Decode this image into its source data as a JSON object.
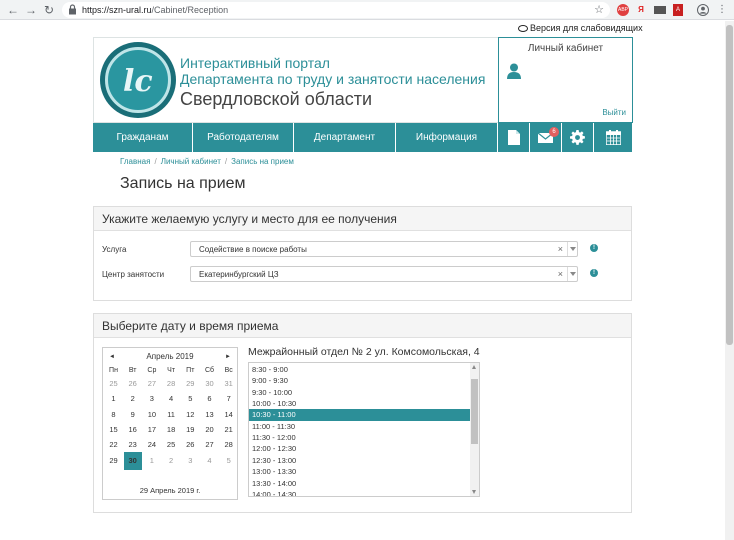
{
  "browser": {
    "url_host": "https://szn-ural.ru",
    "url_path": "/Cabinet/Reception"
  },
  "a11y_link": "Версия для слабовидящих",
  "header": {
    "line1": "Интерактивный портал",
    "line2": "Департамента по труду и занятости населения",
    "line3": "Свердловской области",
    "cabinet_title": "Личный кабинет",
    "logout": "Выйти"
  },
  "nav": {
    "items": [
      "Гражданам",
      "Работодателям",
      "Департамент",
      "Информация"
    ],
    "mail_count": "6"
  },
  "breadcrumb": [
    "Главная",
    "Личный кабинет",
    "Запись на прием"
  ],
  "page_title": "Запись на прием",
  "service_panel": {
    "title": "Укажите желаемую услугу и место для ее получения",
    "service_label": "Услуга",
    "service_value": "Содействие в поиске работы",
    "center_label": "Центр занятости",
    "center_value": "Екатеринбургский ЦЗ"
  },
  "date_panel": {
    "title": "Выберите дату и время приема",
    "calendar": {
      "month": "Апрель 2019",
      "weekdays": [
        "Пн",
        "Вт",
        "Ср",
        "Чт",
        "Пт",
        "Сб",
        "Вс"
      ],
      "weeks": [
        [
          "25",
          "26",
          "27",
          "28",
          "29",
          "30",
          "31"
        ],
        [
          "1",
          "2",
          "3",
          "4",
          "5",
          "6",
          "7"
        ],
        [
          "8",
          "9",
          "10",
          "11",
          "12",
          "13",
          "14"
        ],
        [
          "15",
          "16",
          "17",
          "18",
          "19",
          "20",
          "21"
        ],
        [
          "22",
          "23",
          "24",
          "25",
          "26",
          "27",
          "28"
        ],
        [
          "29",
          "30",
          "1",
          "2",
          "3",
          "4",
          "5"
        ]
      ],
      "selected_date": "29 Апрель 2019 г."
    },
    "office": "Межрайонный отдел № 2 ул. Комсомольская, 4",
    "slots": [
      "8:30 - 9:00",
      "9:00 - 9:30",
      "9:30 - 10:00",
      "10:00 - 10:30",
      "10:30 - 11:00",
      "11:00 - 11:30",
      "11:30 - 12:00",
      "12:00 - 12:30",
      "12:30 - 13:00",
      "13:00 - 13:30",
      "13:30 - 14:00",
      "14:00 - 14:30"
    ],
    "selected_slot": "10:30 - 11:00"
  },
  "colors": {
    "accent": "#2c8f98",
    "badge": "#e25f5f"
  }
}
